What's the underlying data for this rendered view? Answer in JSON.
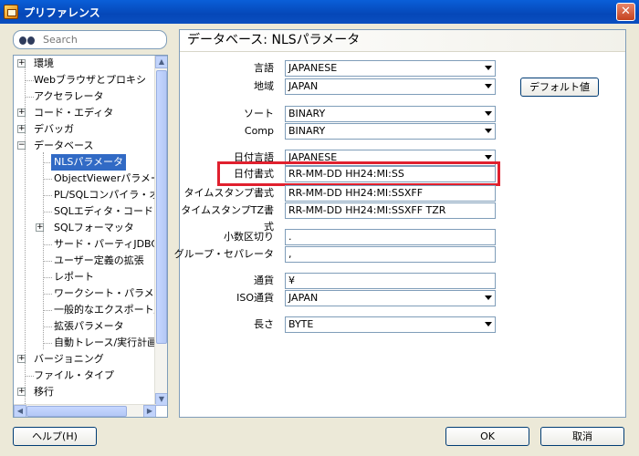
{
  "window": {
    "title": "プリファレンス",
    "close_glyph": "✕"
  },
  "search": {
    "placeholder": "Search"
  },
  "tree": {
    "items": [
      {
        "label": "環境",
        "expander": "+"
      },
      {
        "label": "Webブラウザとプロキシ"
      },
      {
        "label": "アクセラレータ"
      },
      {
        "label": "コード・エディタ",
        "expander": "+"
      },
      {
        "label": "デバッガ",
        "expander": "+"
      },
      {
        "label": "データベース",
        "expander": "−"
      },
      {
        "label": "NLSパラメータ",
        "selected": true
      },
      {
        "label": "ObjectViewerパラメータ"
      },
      {
        "label": "PL/SQLコンパイラ・オプション"
      },
      {
        "label": "SQLエディタ・コード・テンプレート"
      },
      {
        "label": "SQLフォーマッタ",
        "expander": "+"
      },
      {
        "label": "サード・パーティJDBCドライバ"
      },
      {
        "label": "ユーザー定義の拡張"
      },
      {
        "label": "レポート"
      },
      {
        "label": "ワークシート・パラメータ"
      },
      {
        "label": "一般的なエクスポート/インポート"
      },
      {
        "label": "拡張パラメータ"
      },
      {
        "label": "自動トレース/実行計画"
      },
      {
        "label": "バージョニング",
        "expander": "+"
      },
      {
        "label": "ファイル・タイプ"
      },
      {
        "label": "移行",
        "expander": "+"
      }
    ]
  },
  "panel": {
    "title": "データベース: NLSパラメータ",
    "fields": {
      "language": {
        "label": "言語",
        "value": "JAPANESE"
      },
      "territory": {
        "label": "地域",
        "value": "JAPAN"
      },
      "sort": {
        "label": "ソート",
        "value": "BINARY"
      },
      "comp": {
        "label": "Comp",
        "value": "BINARY"
      },
      "date_language": {
        "label": "日付言語",
        "value": "JAPANESE"
      },
      "date_format": {
        "label": "日付書式",
        "value": "RR-MM-DD HH24:MI:SS"
      },
      "timestamp_format": {
        "label": "タイムスタンプ書式",
        "value": "RR-MM-DD HH24:MI:SSXFF"
      },
      "timestamp_tz_format": {
        "label": "タイムスタンプTZ書式",
        "value": "RR-MM-DD HH24:MI:SSXFF TZR"
      },
      "decimal_separator": {
        "label": "小数区切り",
        "value": "."
      },
      "group_separator": {
        "label": "グループ・セパレータ",
        "value": ","
      },
      "currency": {
        "label": "通貨",
        "value": "¥"
      },
      "iso_currency": {
        "label": "ISO通貨",
        "value": "JAPAN"
      },
      "length": {
        "label": "長さ",
        "value": "BYTE"
      }
    },
    "default_button": "デフォルト値"
  },
  "footer": {
    "help": "ヘルプ(H)",
    "ok": "OK",
    "cancel": "取消"
  },
  "colors": {
    "title_bar": "#0a5fd8",
    "selection": "#316ac5",
    "highlight_border": "#e0202e"
  }
}
